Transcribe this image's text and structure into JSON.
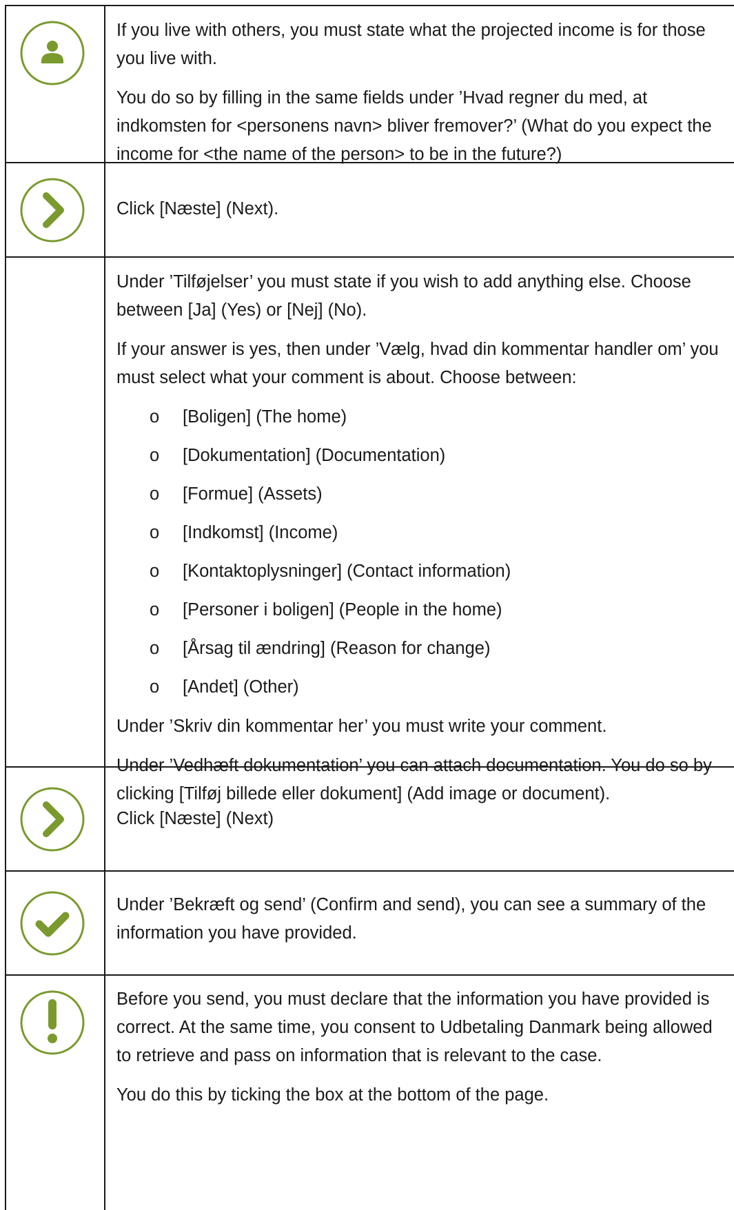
{
  "colors": {
    "accent": "#7a9a2e",
    "border": "#1a1a1a"
  },
  "rows": [
    {
      "icon": "person-icon",
      "paragraphs": [
        "If you live with others, you must state what the projected income is for those you live with.",
        "You do so by filling in the same fields under ’Hvad regner du med, at indkomsten for <personens navn> bliver fremover?’ (What do you expect the income for <the name of the person> to be in the future?)"
      ]
    },
    {
      "icon": "chevron-right-icon",
      "paragraphs": [
        "Click [Næste] (Next)."
      ]
    },
    {
      "icon": "",
      "paragraphs_before": [
        "Under ’Tilføjelser’ you must state if you wish to add anything else. Choose between [Ja] (Yes) or [Nej] (No).",
        "If your answer is yes, then under ’Vælg, hvad din kommentar handler om’ you must select what your comment is about. Choose between:"
      ],
      "bullet": "o",
      "options": [
        "[Boligen] (The home)",
        "[Dokumentation] (Documentation)",
        "[Formue] (Assets)",
        "[Indkomst] (Income)",
        "[Kontaktoplysninger] (Contact information)",
        "[Personer i boligen] (People in the home)",
        "[Årsag til ændring] (Reason for change)",
        "[Andet] (Other)"
      ],
      "paragraphs_after": [
        "Under ’Skriv din kommentar her’ you must write your comment.",
        "Under ’Vedhæft dokumentation’ you can attach documentation. You do so by clicking [Tilføj billede eller dokument] (Add image or document)."
      ]
    },
    {
      "icon": "chevron-right-icon",
      "paragraphs": [
        "Click [Næste] (Next)"
      ]
    },
    {
      "icon": "checkmark-icon",
      "paragraphs": [
        "Under ’Bekræft og send’ (Confirm and send), you can see a summary of the information you have provided."
      ]
    },
    {
      "icon": "exclamation-icon",
      "paragraphs": [
        "Before you send, you must declare that the information you have provided is correct. At the same time, you consent to Udbetaling Danmark being allowed to retrieve and pass on information that is relevant to the case.",
        "You do this by ticking the box at the bottom of the page."
      ]
    }
  ]
}
